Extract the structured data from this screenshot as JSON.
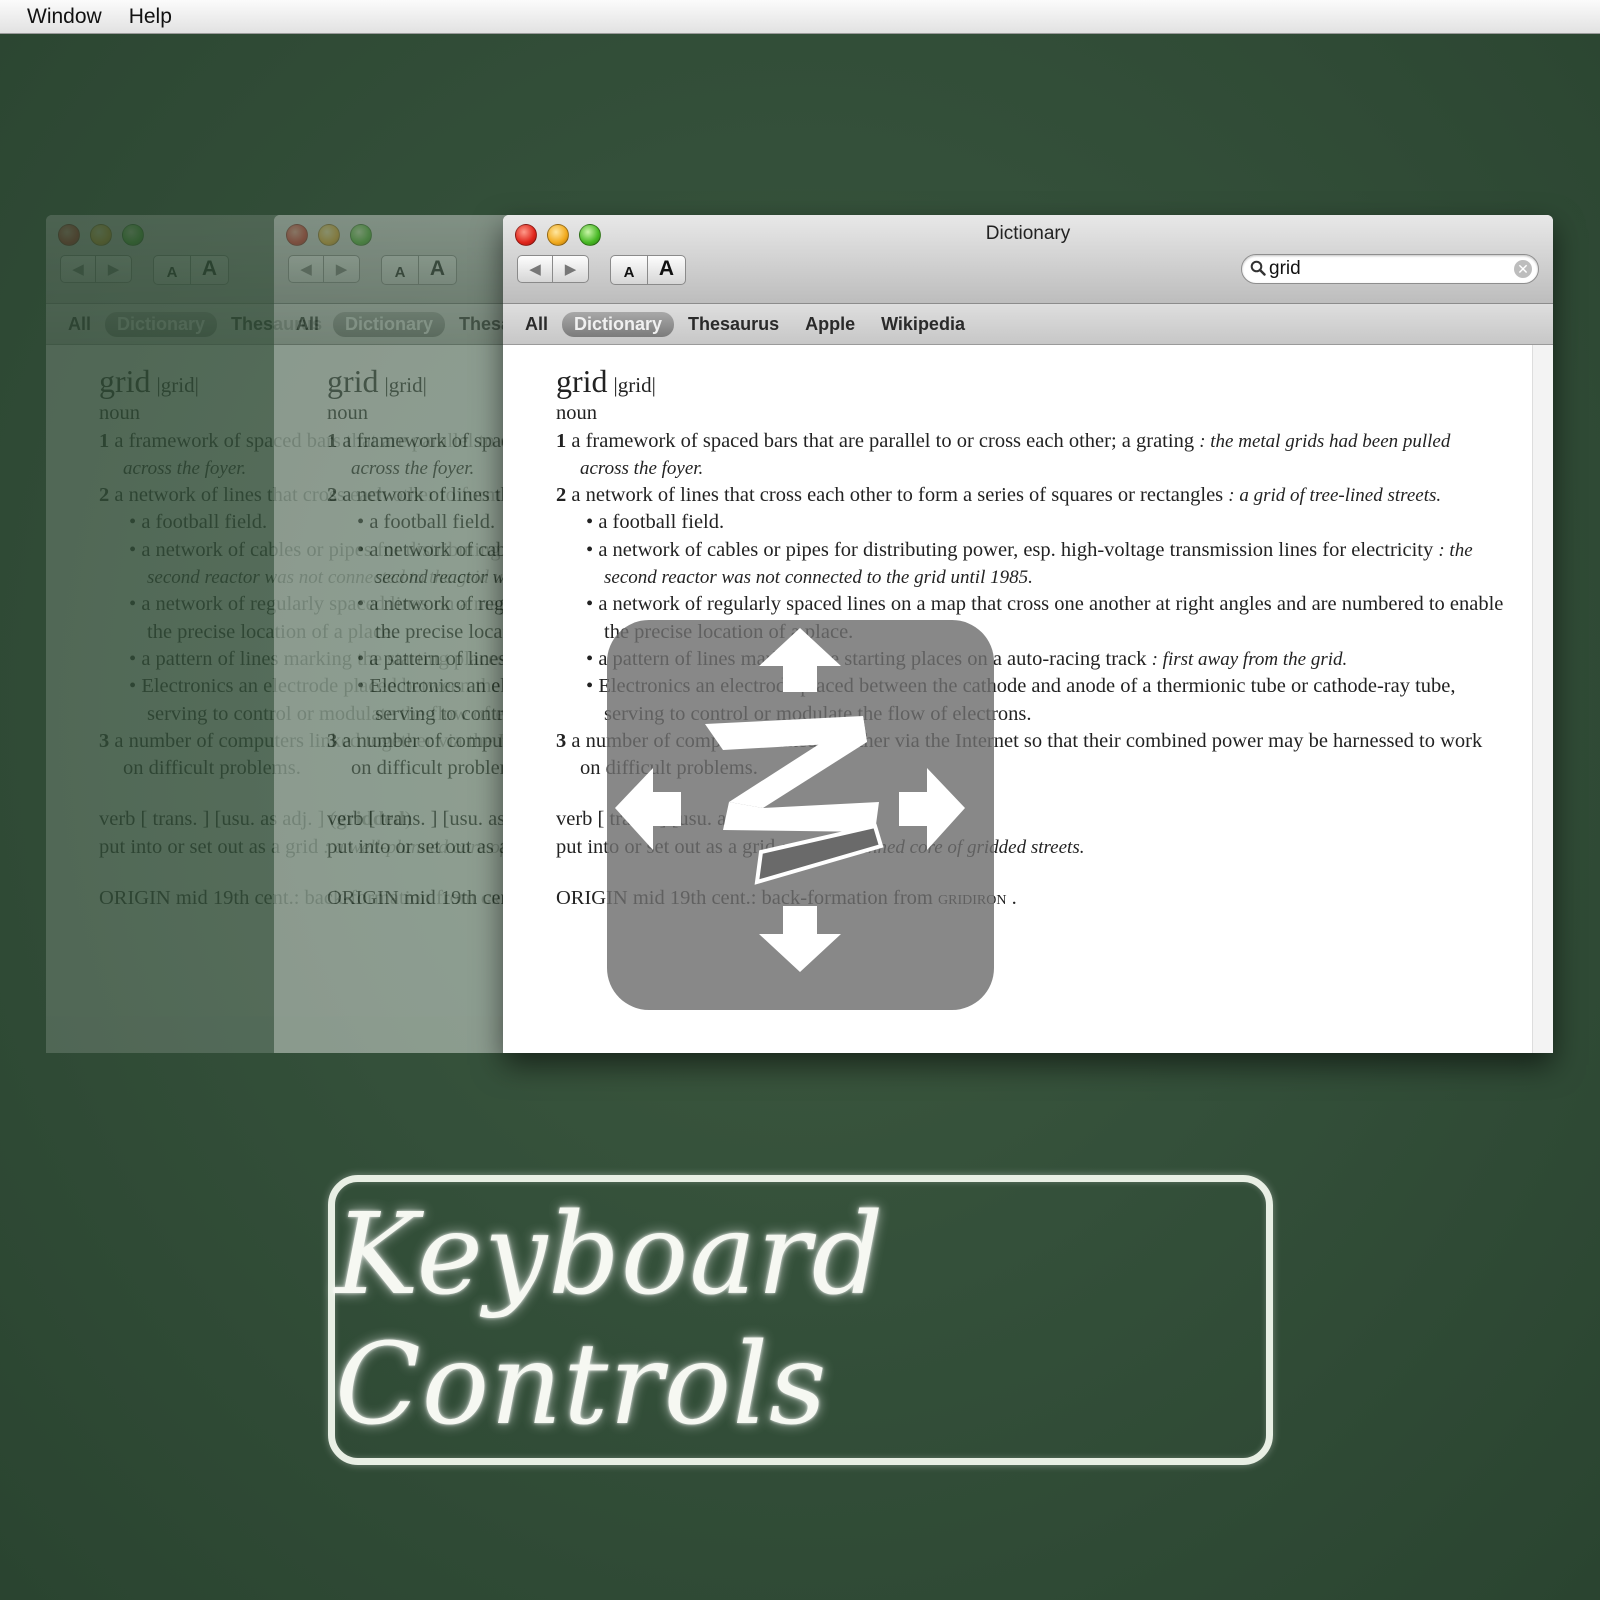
{
  "menubar": {
    "items": [
      "Window",
      "Help"
    ]
  },
  "window": {
    "title": "Dictionary",
    "search_value": "grid",
    "font_small": "A",
    "font_big": "A",
    "scopes": [
      "All",
      "Dictionary",
      "Thesaurus",
      "Apple",
      "Wikipedia"
    ],
    "selected_scope": "Dictionary"
  },
  "entry": {
    "headword": "grid",
    "pron": "|grid|",
    "pos_noun": "noun",
    "s1_num": "1",
    "s1_text": "a framework of spaced bars that are parallel to or cross each other; a grating",
    "s1_ex": ": the metal grids had been pulled across the foyer.",
    "s2_num": "2",
    "s2_text": "a network of lines that cross each other to form a series of squares or rectangles",
    "s2_ex": ": a grid of tree-lined streets.",
    "s2a": "a football field.",
    "s2b_text": "a network of cables or pipes for distributing power, esp. high-voltage transmission lines for electricity",
    "s2b_ex": ": the second reactor was not connected to the grid until 1985.",
    "s2c": "a network of regularly spaced lines on a map that cross one another at right angles and are numbered to enable the precise location of a place.",
    "s2d_text": "a pattern of lines marking the starting places on a auto-racing track",
    "s2d_ex": ": first away from the grid.",
    "s2e": "Electronics an electrode placed between the cathode and anode of a thermionic tube or cathode-ray tube, serving to control or modulate the flow of electrons.",
    "s3_num": "3",
    "s3_text": "a number of computers linked together via the Internet so that their combined power may be harnessed to work on difficult problems.",
    "verb_line": "verb [ trans. ] [usu. as adj. ] (",
    "verb_bold": "gridded",
    "verb_close": ")",
    "verb_def": "put into or set out as a grid",
    "verb_ex": ": a well-planned core of gridded streets.",
    "origin": "ORIGIN mid 19th cent.: back-formation from",
    "origin_ref": "gridiron",
    "origin_end": "."
  },
  "overlay": {
    "icon": "keyboard-arrows-icon"
  },
  "banner": {
    "text": "Keyboard Controls"
  }
}
